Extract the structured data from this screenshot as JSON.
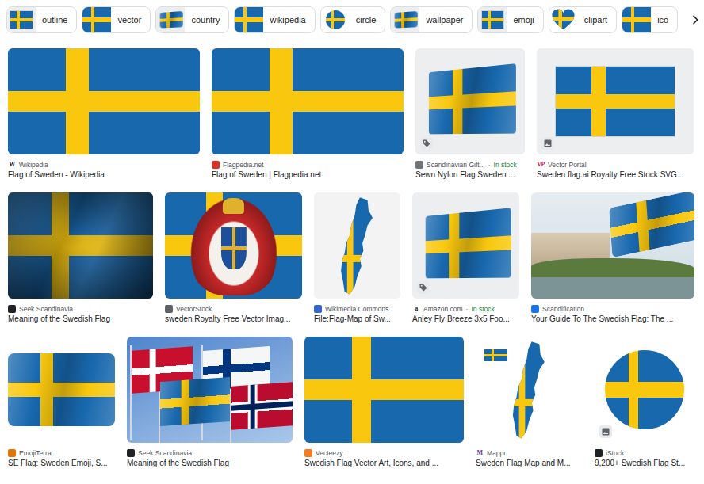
{
  "chips": [
    {
      "label": "outline",
      "kind": "framed"
    },
    {
      "label": "vector",
      "kind": "flag"
    },
    {
      "label": "country",
      "kind": "wavy"
    },
    {
      "label": "wikipedia",
      "kind": "flag"
    },
    {
      "label": "circle",
      "kind": "circle"
    },
    {
      "label": "wallpaper",
      "kind": "wavy"
    },
    {
      "label": "emoji",
      "kind": "framed"
    },
    {
      "label": "clipart",
      "kind": "heart"
    },
    {
      "label": "ico",
      "kind": "flag"
    }
  ],
  "stock_separator": "·",
  "results": [
    [
      {
        "source": "Wikipedia",
        "favicon": {
          "text": "W",
          "color": "#202124"
        },
        "title": "Flag of Sweden - Wikipedia",
        "kind": "flag",
        "badge": "none"
      },
      {
        "source": "Flagpedia.net",
        "favicon": {
          "color": "#d93025"
        },
        "title": "Flag of Sweden | Flagpedia.net",
        "kind": "flag",
        "badge": "none"
      },
      {
        "source": "Scandinavian Gift...",
        "favicon": {
          "color": "#70757a"
        },
        "stock": "In stock",
        "title": "Sewn Nylon Flag Sweden ...",
        "kind": "wavy",
        "badge": "product"
      },
      {
        "source": "Vector Portal",
        "favicon": {
          "text": "VP",
          "color": "#c2185b"
        },
        "title": "Sweden flag.ai Royalty Free Stock SVG...",
        "kind": "framed",
        "badge": "image"
      }
    ],
    [
      {
        "source": "Seek Scandinavia",
        "favicon": {
          "color": "#202124"
        },
        "title": "Meaning of the Swedish Flag",
        "kind": "shaded",
        "badge": "none"
      },
      {
        "source": "VectorStock",
        "favicon": {
          "color": "#5f6368"
        },
        "title": "sweden Royalty Free Vector Imag...",
        "kind": "coat",
        "badge": "none"
      },
      {
        "source": "Wikimedia Commons",
        "favicon": {
          "color": "#3366cc"
        },
        "title": "File:Flag-Map of Sw...",
        "kind": "map",
        "badge": "none"
      },
      {
        "source": "Amazon.com",
        "favicon": {
          "text": "a",
          "color": "#202124"
        },
        "stock": "In stock",
        "title": "Anley Fly Breeze 3x5 Foo...",
        "kind": "wavy",
        "badge": "product"
      },
      {
        "source": "Scandification",
        "favicon": {
          "color": "#1a73e8"
        },
        "title": "Your Guide To The Swedish Flag: The ...",
        "kind": "photo",
        "badge": "none"
      }
    ],
    [
      {
        "source": "EmojiTerra",
        "favicon": {
          "color": "#e37400"
        },
        "title": "SE Flag: Sweden Emoji, S...",
        "kind": "emoji",
        "badge": "none"
      },
      {
        "source": "Seek Scandinavia",
        "favicon": {
          "color": "#202124"
        },
        "title": "Meaning of the Swedish Flag",
        "kind": "flags",
        "badge": "none"
      },
      {
        "source": "Vecteezy",
        "favicon": {
          "color": "#f47b20"
        },
        "title": "Swedish Flag Vector Art, Icons, and ...",
        "kind": "flag",
        "badge": "none"
      },
      {
        "source": "Mappr",
        "favicon": {
          "text": "M",
          "color": "#6b3fa0"
        },
        "title": "Sweden Flag Map and M...",
        "kind": "map-flag",
        "badge": "none"
      },
      {
        "source": "iStock",
        "favicon": {
          "color": "#202124"
        },
        "title": "9,200+ Swedish Flag St...",
        "kind": "circle",
        "badge": "image"
      }
    ]
  ]
}
